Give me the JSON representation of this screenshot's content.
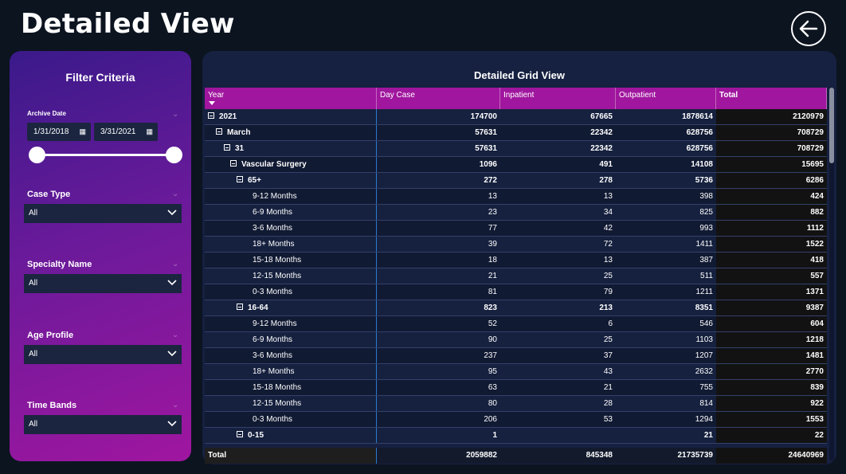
{
  "page": {
    "title": "Detailed View"
  },
  "filters": {
    "title": "Filter Criteria",
    "archive_date": {
      "label": "Archive Date",
      "start": "1/31/2018",
      "end": "3/31/2021"
    },
    "case_type": {
      "label": "Case Type",
      "value": "All"
    },
    "specialty": {
      "label": "Specialty Name",
      "value": "All"
    },
    "age_profile": {
      "label": "Age Profile",
      "value": "All"
    },
    "time_bands": {
      "label": "Time Bands",
      "value": "All"
    }
  },
  "grid": {
    "title": "Detailed Grid View",
    "columns": [
      "Year",
      "Day Case",
      "Inpatient",
      "Outpatient",
      "Total"
    ],
    "rows": [
      {
        "indent": 0,
        "toggle": true,
        "bold": true,
        "label": "2021",
        "day": "174700",
        "inp": "67665",
        "out": "1878614",
        "tot": "2120979"
      },
      {
        "indent": 1,
        "toggle": true,
        "bold": true,
        "label": "March",
        "day": "57631",
        "inp": "22342",
        "out": "628756",
        "tot": "708729"
      },
      {
        "indent": 2,
        "toggle": true,
        "bold": true,
        "label": "31",
        "day": "57631",
        "inp": "22342",
        "out": "628756",
        "tot": "708729"
      },
      {
        "indent": 3,
        "toggle": true,
        "bold": true,
        "label": "Vascular Surgery",
        "day": "1096",
        "inp": "491",
        "out": "14108",
        "tot": "15695"
      },
      {
        "indent": 4,
        "toggle": true,
        "bold": true,
        "label": "65+",
        "day": "272",
        "inp": "278",
        "out": "5736",
        "tot": "6286"
      },
      {
        "indent": 5,
        "toggle": false,
        "bold": false,
        "label": "9-12 Months",
        "day": "13",
        "inp": "13",
        "out": "398",
        "tot": "424"
      },
      {
        "indent": 5,
        "toggle": false,
        "bold": false,
        "label": "6-9 Months",
        "day": "23",
        "inp": "34",
        "out": "825",
        "tot": "882"
      },
      {
        "indent": 5,
        "toggle": false,
        "bold": false,
        "label": "3-6 Months",
        "day": "77",
        "inp": "42",
        "out": "993",
        "tot": "1112"
      },
      {
        "indent": 5,
        "toggle": false,
        "bold": false,
        "label": "18+ Months",
        "day": "39",
        "inp": "72",
        "out": "1411",
        "tot": "1522"
      },
      {
        "indent": 5,
        "toggle": false,
        "bold": false,
        "label": "15-18 Months",
        "day": "18",
        "inp": "13",
        "out": "387",
        "tot": "418"
      },
      {
        "indent": 5,
        "toggle": false,
        "bold": false,
        "label": "12-15 Months",
        "day": "21",
        "inp": "25",
        "out": "511",
        "tot": "557"
      },
      {
        "indent": 5,
        "toggle": false,
        "bold": false,
        "label": "0-3 Months",
        "day": "81",
        "inp": "79",
        "out": "1211",
        "tot": "1371"
      },
      {
        "indent": 4,
        "toggle": true,
        "bold": true,
        "label": "16-64",
        "day": "823",
        "inp": "213",
        "out": "8351",
        "tot": "9387"
      },
      {
        "indent": 5,
        "toggle": false,
        "bold": false,
        "label": "9-12 Months",
        "day": "52",
        "inp": "6",
        "out": "546",
        "tot": "604"
      },
      {
        "indent": 5,
        "toggle": false,
        "bold": false,
        "label": "6-9 Months",
        "day": "90",
        "inp": "25",
        "out": "1103",
        "tot": "1218"
      },
      {
        "indent": 5,
        "toggle": false,
        "bold": false,
        "label": "3-6 Months",
        "day": "237",
        "inp": "37",
        "out": "1207",
        "tot": "1481"
      },
      {
        "indent": 5,
        "toggle": false,
        "bold": false,
        "label": "18+ Months",
        "day": "95",
        "inp": "43",
        "out": "2632",
        "tot": "2770"
      },
      {
        "indent": 5,
        "toggle": false,
        "bold": false,
        "label": "15-18 Months",
        "day": "63",
        "inp": "21",
        "out": "755",
        "tot": "839"
      },
      {
        "indent": 5,
        "toggle": false,
        "bold": false,
        "label": "12-15 Months",
        "day": "80",
        "inp": "28",
        "out": "814",
        "tot": "922"
      },
      {
        "indent": 5,
        "toggle": false,
        "bold": false,
        "label": "0-3 Months",
        "day": "206",
        "inp": "53",
        "out": "1294",
        "tot": "1553"
      },
      {
        "indent": 4,
        "toggle": true,
        "bold": true,
        "label": "0-15",
        "day": "1",
        "inp": "",
        "out": "21",
        "tot": "22"
      }
    ],
    "total": {
      "label": "Total",
      "day": "2059882",
      "inp": "845348",
      "out": "21735739",
      "tot": "24640969"
    }
  },
  "icons": {
    "back": "back-arrow-icon",
    "calendar": "calendar-icon",
    "dropdown": "chevron-down-icon",
    "row_toggle": "collapse-icon"
  },
  "colors": {
    "background": "#0c1420",
    "panel": "#162040",
    "header_accent": "#a0169e",
    "filter_gradient_start": "#3a1a8a",
    "filter_gradient_end": "#a016a0"
  }
}
